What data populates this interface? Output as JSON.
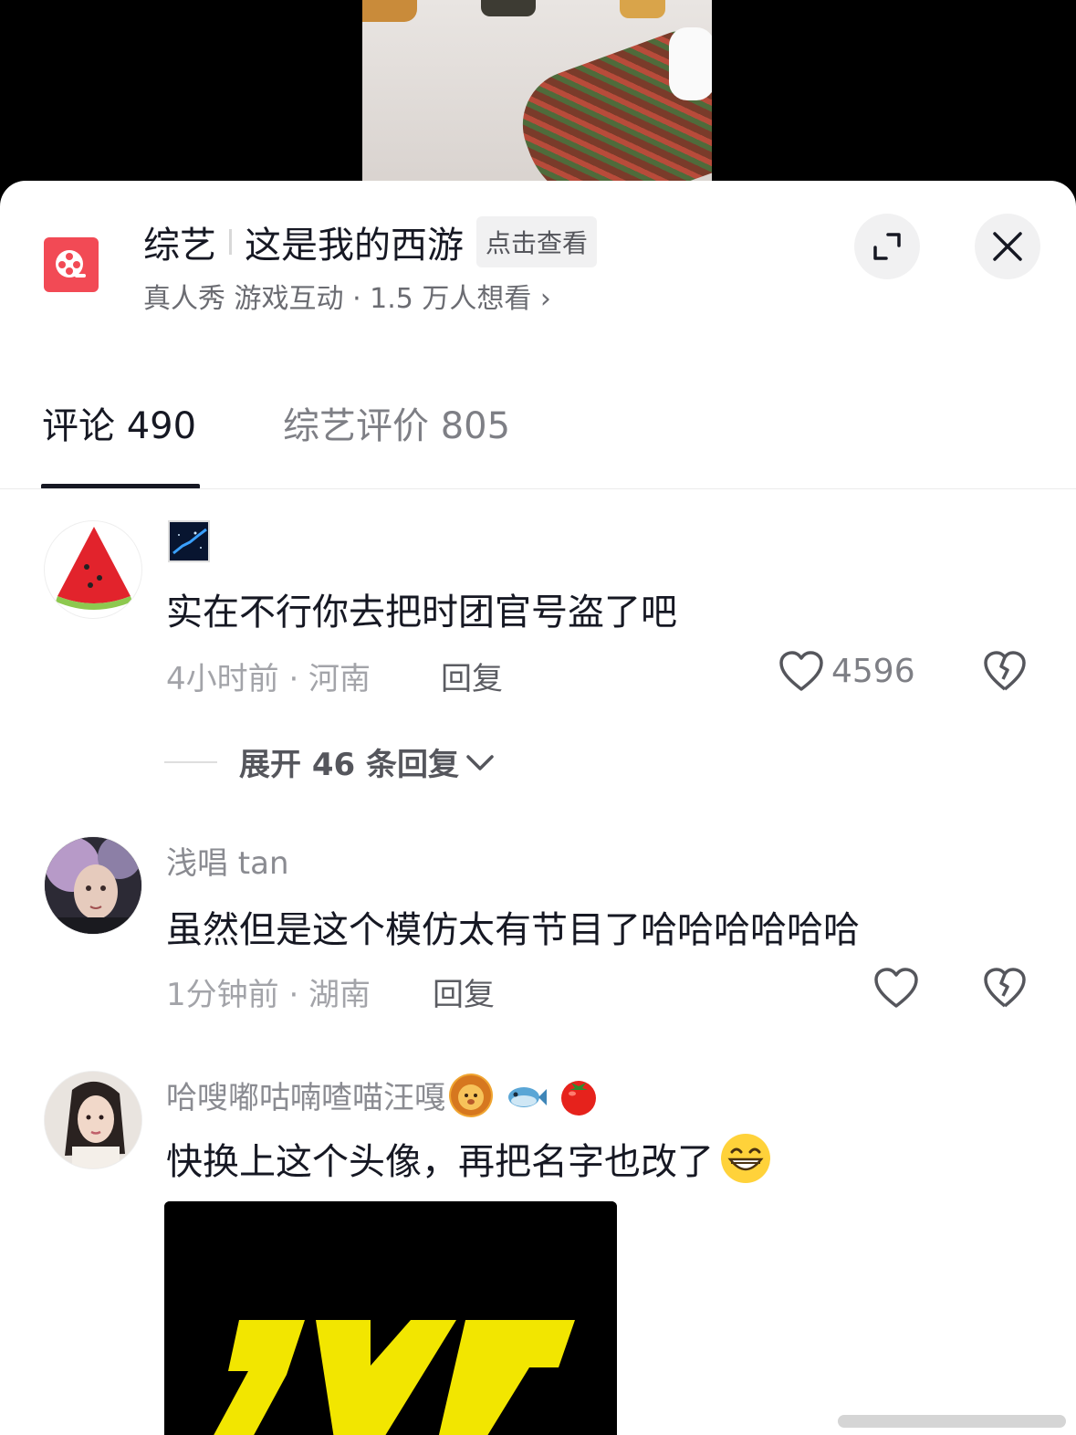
{
  "header": {
    "category": "综艺",
    "show_name": "这是我的西游",
    "view_badge": "点击查看",
    "meta": "真人秀 游戏互动 · 1.5 万人想看 ›"
  },
  "tabs": [
    {
      "label": "评论 490",
      "active": true
    },
    {
      "label": "综艺评价 805",
      "active": false
    }
  ],
  "comments": [
    {
      "name": "",
      "text": "实在不行你去把时团官号盗了吧",
      "time_location": "4小时前 · 河南",
      "reply_label": "回复",
      "likes": "4596"
    },
    {
      "name": "浅唱 tan",
      "text": "虽然但是这个模仿太有节目了哈哈哈哈哈哈",
      "time_location": "1分钟前 · 湖南",
      "reply_label": "回复",
      "likes": ""
    },
    {
      "name": "哈嗖嘟咕喃喳喵汪嘎",
      "text": "快换上这个头像，再把名字也改了",
      "emoji_after_name": [
        "lion-emoji",
        "fish-emoji",
        "tomato-emoji"
      ],
      "emoji_after_text": "grin-emoji"
    }
  ],
  "expand_replies": "展开 46 条回复",
  "colors": {
    "accent_red": "#f24a55",
    "text_primary": "#161823",
    "text_secondary": "#8a8b91",
    "image_yellow": "#f2e600"
  }
}
